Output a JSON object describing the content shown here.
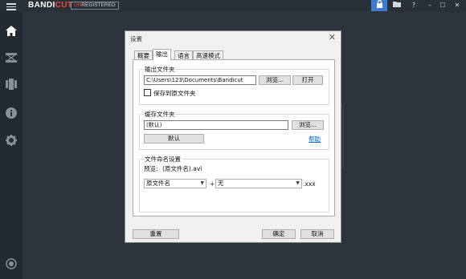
{
  "app": {
    "logo_main": "BANDI",
    "logo_accent": "CUT",
    "unreg_accent": "UN",
    "unreg_rest": "REGISTERED",
    "lock_icon": "lock-icon",
    "folder_icon": "folder-icon",
    "help": "?",
    "minimize": "–",
    "maximize": "☐",
    "close": "✕",
    "accent_color": "#3f7ad1",
    "brand_red": "#e84b3a"
  },
  "sidebar": {
    "items": [
      {
        "name": "home-icon"
      },
      {
        "name": "cut-icon"
      },
      {
        "name": "join-icon"
      },
      {
        "name": "info-icon"
      },
      {
        "name": "settings-icon"
      }
    ],
    "bottom": {
      "name": "record-icon"
    }
  },
  "dialog": {
    "title": "设置",
    "close": "✕",
    "tabs": [
      "概要",
      "输出",
      "语言",
      "高速模式"
    ],
    "active_tab": 1,
    "output": {
      "label": "输出文件夹",
      "path": "C:\\Users\\123\\Documents\\Bandicut",
      "browse": "浏览...",
      "open": "打开",
      "save_source_label": "保存到原文件夹",
      "save_source_checked": false
    },
    "cache": {
      "label": "缓存文件夹",
      "path": "(默认)",
      "browse": "浏览...",
      "default": "默认",
      "help": "帮助"
    },
    "naming": {
      "label": "文件命名设置",
      "preview_label": "预览:",
      "preview_value": "(原文件名).avi",
      "select1": "原文件名",
      "plus": "+",
      "select2": "无",
      "ext": ".xxx"
    },
    "buttons": {
      "reset": "重置",
      "ok": "确定",
      "cancel": "取消"
    }
  }
}
